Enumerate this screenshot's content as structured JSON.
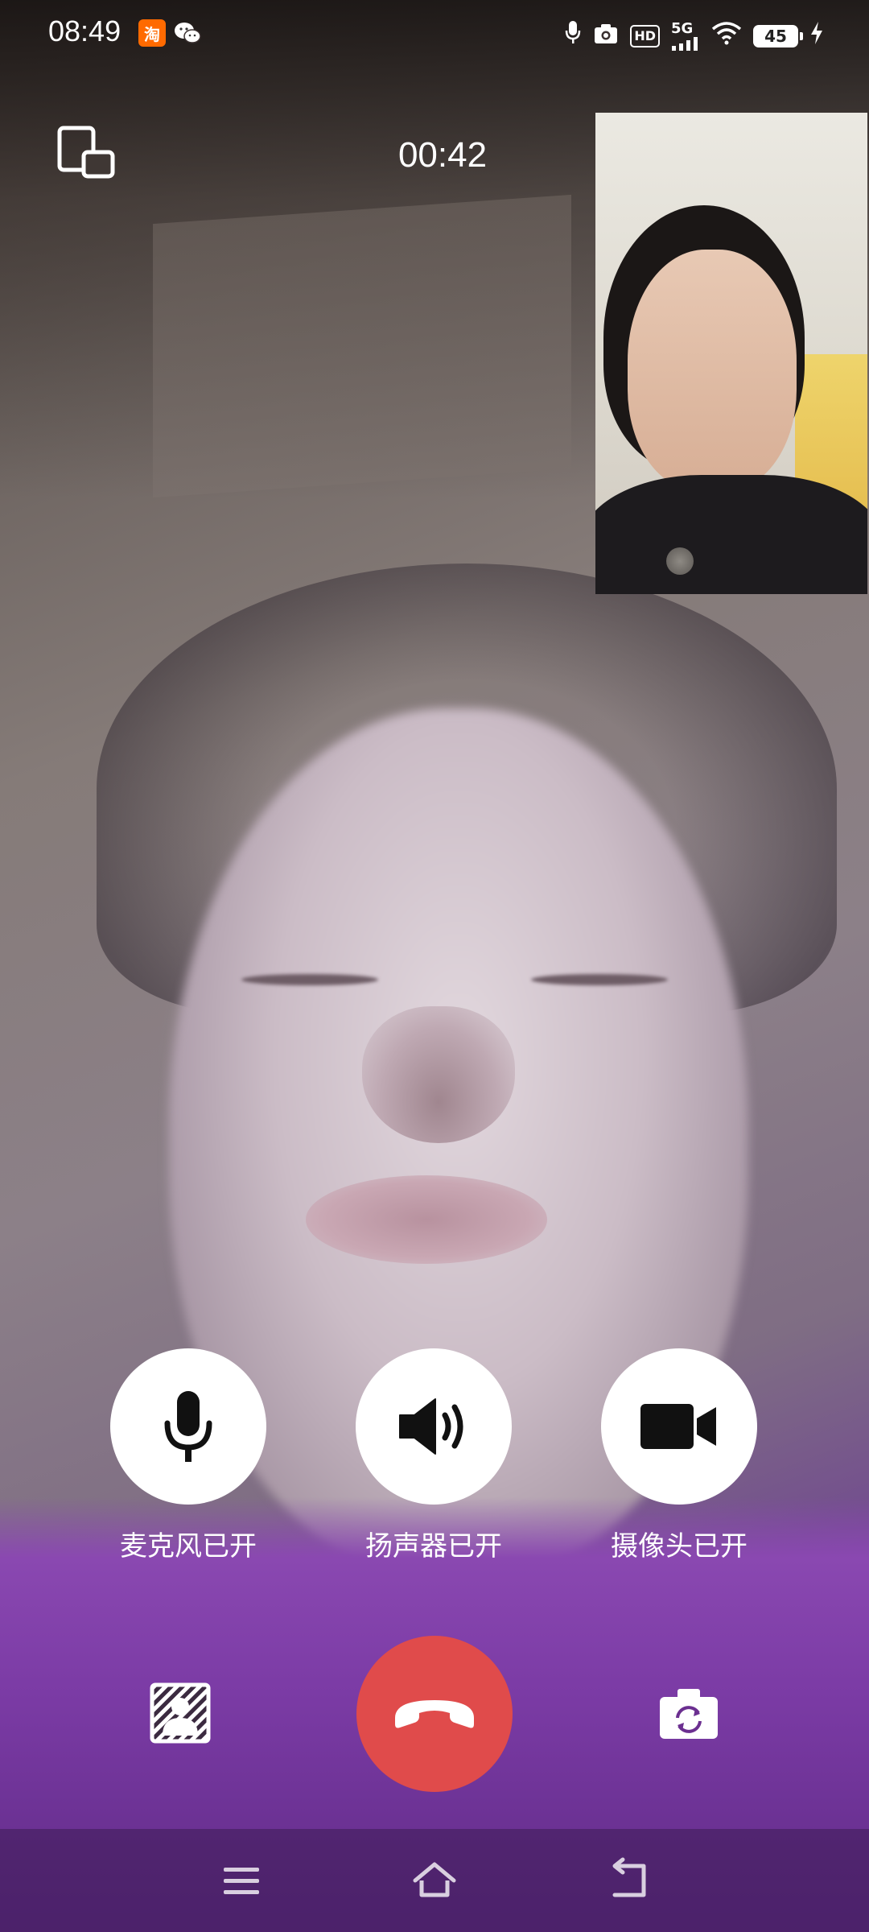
{
  "status_bar": {
    "time": "08:49",
    "left_icons": [
      "taobao-icon",
      "wechat-icon"
    ],
    "right_icons": [
      "microphone-icon",
      "camera-icon",
      "hd-icon",
      "5g-signal-icon",
      "wifi-icon",
      "battery-icon",
      "charging-icon"
    ],
    "hd_label": "HD",
    "network_label": "5G",
    "battery_level": "45"
  },
  "call": {
    "timer": "00:42"
  },
  "controls": [
    {
      "id": "mic",
      "label": "麦克风已开",
      "icon": "microphone-icon",
      "on": true
    },
    {
      "id": "speaker",
      "label": "扬声器已开",
      "icon": "speaker-icon",
      "on": true
    },
    {
      "id": "camera",
      "label": "摄像头已开",
      "icon": "video-camera-icon",
      "on": true
    }
  ],
  "bottom_actions": {
    "left_icon": "background-blur-icon",
    "center_icon": "hang-up-icon",
    "right_icon": "flip-camera-icon"
  },
  "nav_bar": {
    "icons": [
      "menu-icon",
      "home-icon",
      "back-icon"
    ]
  },
  "colors": {
    "hangup": "#e04b4b",
    "control_bg": "#ffffff",
    "text": "#ffffff"
  }
}
